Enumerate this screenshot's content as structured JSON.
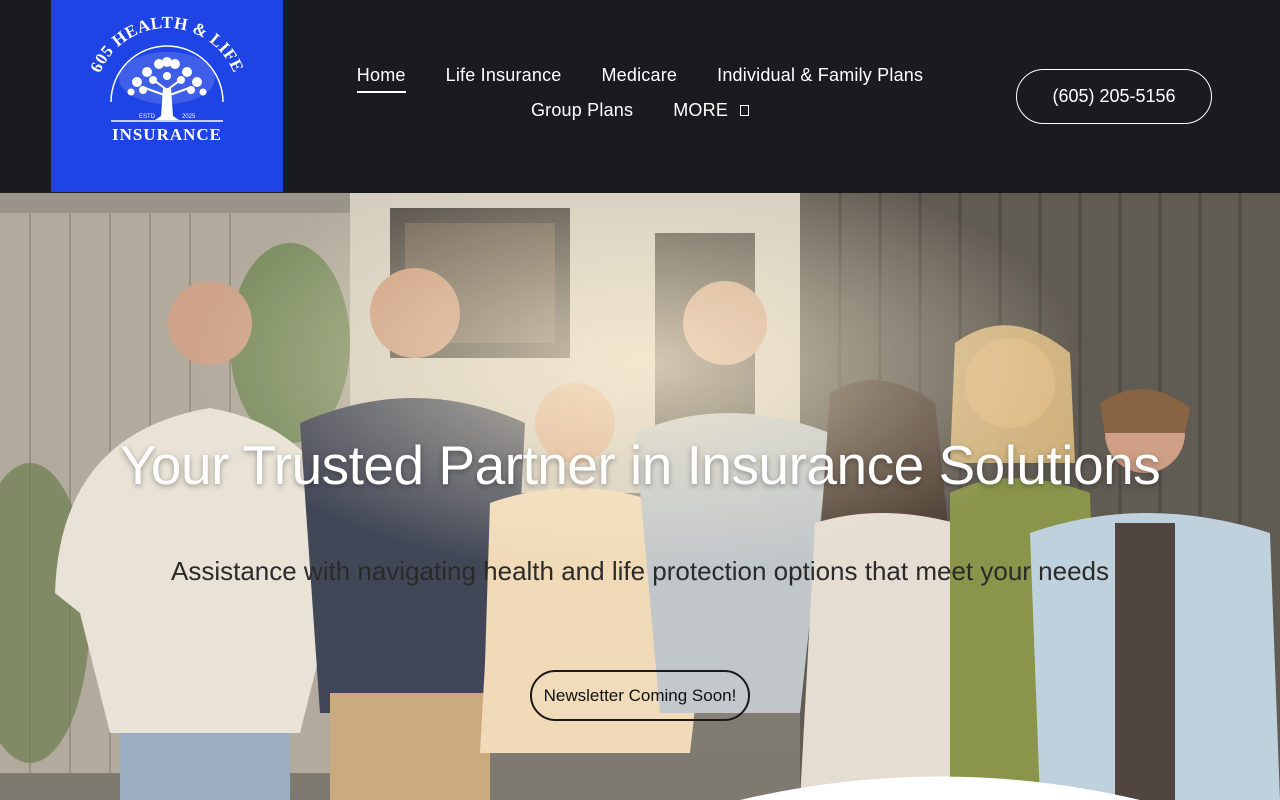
{
  "brand": {
    "logo_text_top": "605 HEALTH & LIFE",
    "logo_text_bottom": "INSURANCE",
    "logo_estd": "ESTD",
    "logo_year": "2025",
    "logo_bg": "#1f44e6"
  },
  "nav": {
    "row1": [
      {
        "label": "Home",
        "active": true
      },
      {
        "label": "Life Insurance",
        "active": false
      },
      {
        "label": "Medicare",
        "active": false
      },
      {
        "label": "Individual & Family Plans",
        "active": false
      }
    ],
    "row2": [
      {
        "label": "Group Plans",
        "active": false
      },
      {
        "label": "MORE",
        "active": false
      }
    ]
  },
  "header": {
    "phone": "(605) 205-5156",
    "bg": "#1a1b1f"
  },
  "hero": {
    "title": "Your Trusted Partner in Insurance Solutions",
    "subtitle": "Assistance with navigating health and life protection options that meet your needs",
    "cta": "Newsletter Coming Soon!"
  }
}
